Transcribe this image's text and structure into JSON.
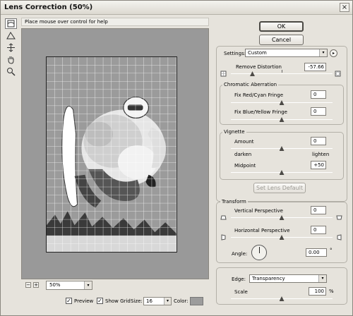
{
  "window": {
    "title": "Lens Correction (50%)",
    "close_glyph": "×"
  },
  "help": {
    "text": "Place mouse over control for help"
  },
  "tools": [
    "remove-distortion-tool-icon",
    "straighten-tool-icon",
    "move-grid-tool-icon",
    "hand-tool-icon",
    "zoom-tool-icon"
  ],
  "zoom": {
    "minus": "−",
    "plus": "+",
    "value": "50%",
    "arrow": "▾"
  },
  "bottom": {
    "preview_label": "Preview",
    "preview_checked": "✓",
    "showgrid_label": "Show Grid",
    "showgrid_checked": "✓",
    "size_label": "Size:",
    "size_value": "16",
    "size_arrow": "▾",
    "color_label": "Color:",
    "color_value": "#9c9c9c"
  },
  "buttons": {
    "ok": "OK",
    "cancel": "Cancel",
    "set_lens_default": "Set Lens Default"
  },
  "settings": {
    "label": "Settings:",
    "value": "Custom",
    "arrow": "▾",
    "menu_glyph": "▸"
  },
  "remove_distortion": {
    "label": "Remove Distortion",
    "value": "-57.66",
    "level": -57.66,
    "range": [
      -100,
      100
    ]
  },
  "chromatic": {
    "title": "Chromatic Aberration",
    "red_cyan": {
      "label": "Fix Red/Cyan Fringe",
      "value": "0",
      "level": 0
    },
    "blue_yellow": {
      "label": "Fix Blue/Yellow Fringe",
      "value": "0",
      "level": 0
    }
  },
  "vignette": {
    "title": "Vignette",
    "amount": {
      "label": "Amount",
      "value": "0",
      "level": 0
    },
    "darken": "darken",
    "lighten": "lighten",
    "midpoint": {
      "label": "Midpoint",
      "value": "+50",
      "level": 50
    }
  },
  "transform": {
    "title": "Transform",
    "vertical": {
      "label": "Vertical Perspective",
      "value": "0",
      "level": 0
    },
    "horizontal": {
      "label": "Horizontal Perspective",
      "value": "0",
      "level": 0
    },
    "angle": {
      "label": "Angle:",
      "value": "0.00",
      "unit": "°"
    },
    "edge": {
      "label": "Edge:",
      "value": "Transparency",
      "arrow": "▾"
    },
    "scale": {
      "label": "Scale",
      "value": "100",
      "unit": "%",
      "level": 100
    }
  }
}
